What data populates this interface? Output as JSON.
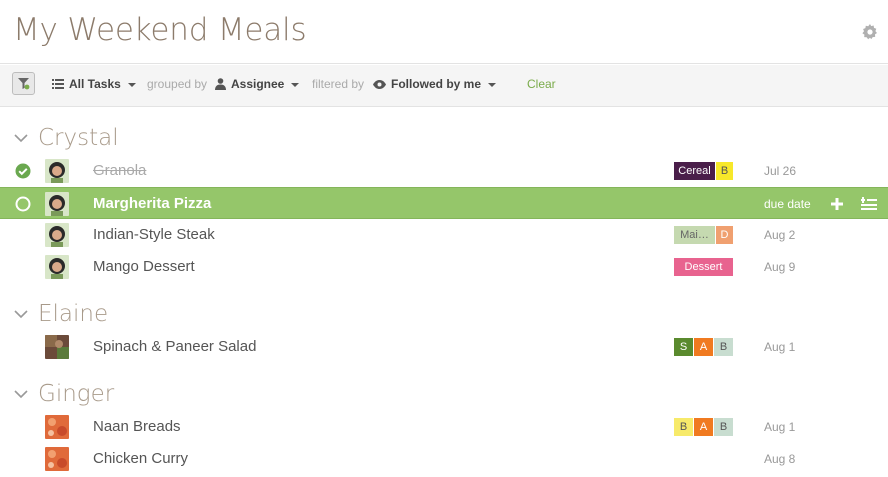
{
  "header": {
    "title": "My Weekend Meals",
    "settings_icon": "gear-icon"
  },
  "toolbar": {
    "filter_icon": "filter-icon",
    "view_label": "All Tasks",
    "grouped_by_prefix": "grouped by",
    "grouped_by_value": "Assignee",
    "filtered_by_prefix": "filtered by",
    "filtered_by_value": "Followed by me",
    "clear_label": "Clear"
  },
  "colors": {
    "selected_row": "#95c66a",
    "check_green": "#6aa84f",
    "clear_link": "#7aab4a"
  },
  "groups": [
    {
      "name": "Crystal",
      "tasks": [
        {
          "name": "Granola",
          "completed": true,
          "tags": [
            {
              "text": "Cereal",
              "bg": "#4a1e4a",
              "fg": "#ffffff"
            },
            {
              "text": "B",
              "bg": "#f7e82a",
              "fg": "#555555"
            }
          ],
          "due": "Jul 26"
        },
        {
          "name": "Margherita Pizza",
          "selected": true,
          "tags": [],
          "due": "due date"
        },
        {
          "name": "Indian-Style Steak",
          "tags": [
            {
              "text": "Mai…",
              "bg": "#c5d9b0",
              "fg": "#666666"
            },
            {
              "text": "D",
              "bg": "#f0a070",
              "fg": "#ffffff"
            }
          ],
          "due": "Aug 2"
        },
        {
          "name": "Mango Dessert",
          "tags": [
            {
              "text": "Dessert",
              "bg": "#e8638f",
              "fg": "#ffffff"
            }
          ],
          "due": "Aug 9"
        }
      ]
    },
    {
      "name": "Elaine",
      "tasks": [
        {
          "name": "Spinach & Paneer Salad",
          "tags": [
            {
              "text": "S",
              "bg": "#5a8a2e",
              "fg": "#ffffff"
            },
            {
              "text": "A",
              "bg": "#f07a20",
              "fg": "#ffffff"
            },
            {
              "text": "B",
              "bg": "#c8ddd0",
              "fg": "#555555"
            }
          ],
          "due": "Aug 1"
        }
      ]
    },
    {
      "name": "Ginger",
      "tasks": [
        {
          "name": "Naan Breads",
          "tags": [
            {
              "text": "B",
              "bg": "#f7ea6a",
              "fg": "#555555"
            },
            {
              "text": "A",
              "bg": "#f07a20",
              "fg": "#ffffff"
            },
            {
              "text": "B",
              "bg": "#c8ddd0",
              "fg": "#555555"
            }
          ],
          "due": "Aug 1"
        },
        {
          "name": "Chicken Curry",
          "tags": [],
          "due": "Aug 8"
        }
      ]
    }
  ]
}
